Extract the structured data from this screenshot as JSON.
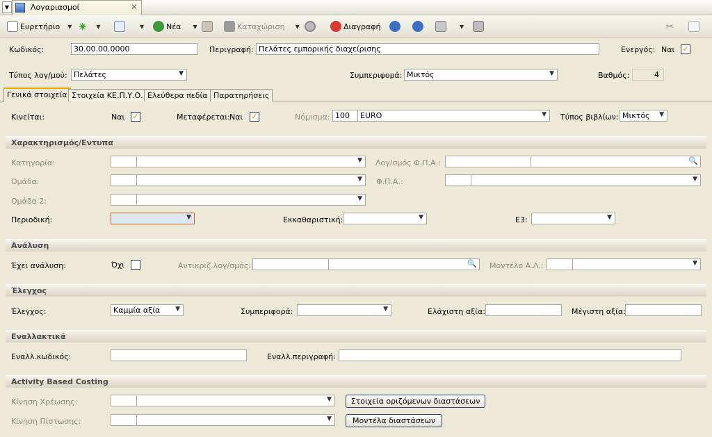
{
  "window": {
    "tab_title": "Λογαριασμοί"
  },
  "toolbar": {
    "index": "Ευρετήριο",
    "new": "Νέα",
    "save": "Καταχώριση",
    "delete": "Διαγραφή"
  },
  "header": {
    "code_label": "Κωδικός:",
    "code_value": "30.00.00.0000",
    "desc_label": "Περιγραφή:",
    "desc_value": "Πελάτες εμπορικής διαχείρισης",
    "active_label": "Ενεργός:",
    "active_value": "Ναι",
    "type_label": "Τύπος λογ/μού:",
    "type_value": "Πελάτες",
    "behavior_label": "Συμπεριφορά:",
    "behavior_value": "Μικτός",
    "level_label": "Βαθμός:",
    "level_value": "4"
  },
  "tabs": [
    "Γενικά στοιχεία",
    "Στοιχεία ΚΕ.Π.Υ.Ο.",
    "Ελεύθερα πεδία",
    "Παρατηρήσεις"
  ],
  "general": {
    "moves_label": "Κινείται:",
    "moves_value": "Ναι",
    "transfers_label": "Μεταφέρεται:",
    "transfers_value": "Ναι",
    "currency_label": "Νόμισμα:",
    "currency_code": "100",
    "currency_name": "EURO",
    "books_label": "Τύπος βιβλίων:",
    "books_value": "Μικτός"
  },
  "sections": {
    "characterization": "Χαρακτηρισμός/Εντυπα",
    "analysis": "Ανάλυση",
    "control": "Έλεγχος",
    "alternative": "Εναλλακτικά",
    "abc": "Activity Based Costing"
  },
  "characterization": {
    "category": "Κατηγορία:",
    "vat_account": "Λογ/σμός Φ.Π.Α.:",
    "group": "Ομάδα:",
    "vat": "Φ.Π.Α.:",
    "group2": "Ομάδα 2:",
    "periodic": "Περιοδική:",
    "clearing": "Εκκαθαριστική:",
    "e3": "Ε3:"
  },
  "analysis": {
    "has_label": "Έχει ανάλυση:",
    "has_value": "Όχι",
    "counter_label": "Αντικριζ.λογ/σμός:",
    "model_label": "Μοντέλο Α.Λ.:"
  },
  "control": {
    "control_label": "Έλεγχος:",
    "control_value": "Καμμία αξία",
    "behavior_label": "Συμπεριφορά:",
    "min_label": "Ελάχιστη αξία:",
    "max_label": "Μέγιστη αξία:"
  },
  "alternative": {
    "code_label": "Εναλλ.κωδικός:",
    "desc_label": "Εναλλ.περιγραφή:"
  },
  "abc": {
    "debit_label": "Κίνηση Χρέωσης:",
    "credit_label": "Κίνηση Πίστωσης:",
    "dims_button": "Στοιχεία οριζόμενων διαστάσεων",
    "models_button": "Μοντέλα διαστάσεων"
  },
  "colors": {
    "accent": "#e6a700",
    "focus_field": "#dce7f2",
    "section_bg": "#d6d3c2"
  },
  "icons": [
    "menu-arrow-icon",
    "window-icon",
    "close-icon",
    "star-icon",
    "search-icon",
    "add-icon",
    "copy-icon",
    "save-icon",
    "target-icon",
    "delete-icon",
    "prev-icon",
    "next-icon",
    "print-icon",
    "tools-icon",
    "cut-icon",
    "page-icon",
    "magnifier-icon",
    "checkmark-icon"
  ]
}
